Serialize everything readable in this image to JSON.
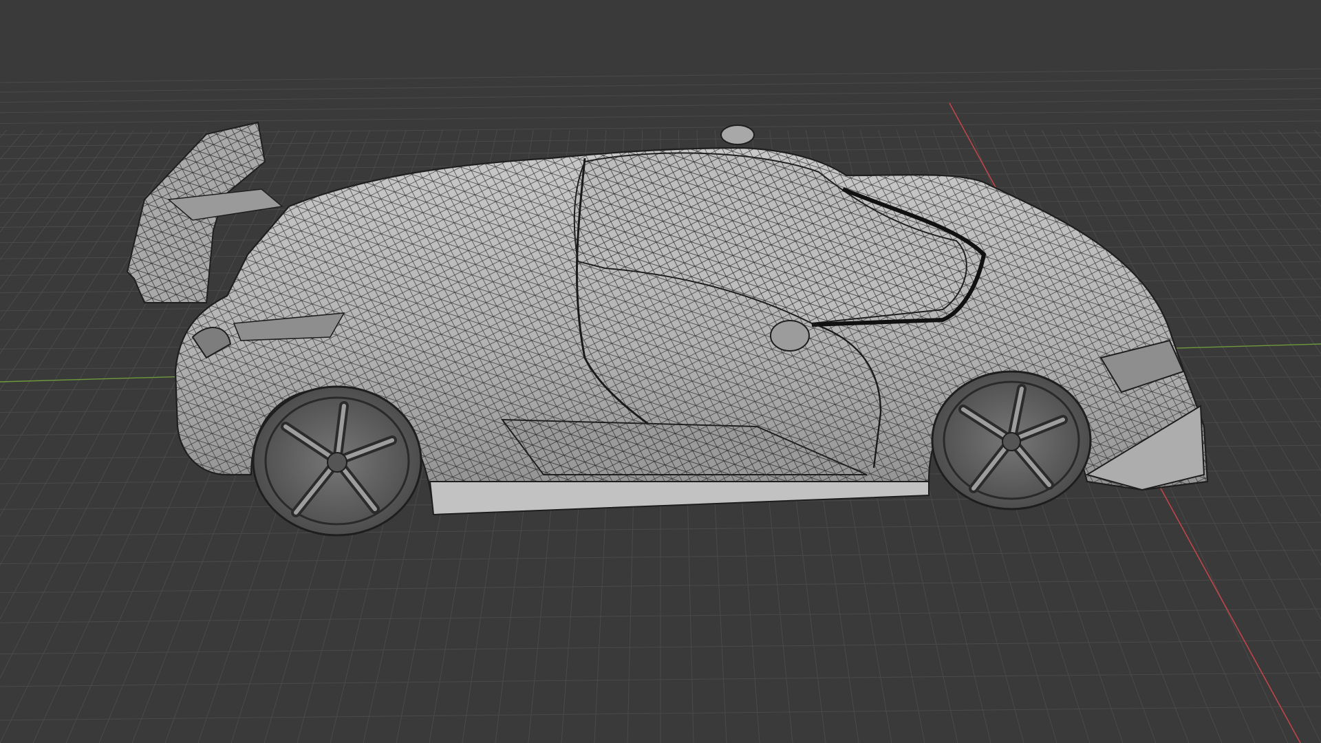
{
  "viewport": {
    "mode": "3d-viewport",
    "shading": "solid-wireframe-overlay",
    "object": "sports-car-mesh",
    "background_color": "#3a3a3a",
    "grid_color": "#4a4a4a",
    "x_axis_color": "#c0444a",
    "y_axis_color": "#6f9a3c",
    "mesh_fill_color": "#b7b7b7",
    "wire_color": "#1e1e1e"
  }
}
